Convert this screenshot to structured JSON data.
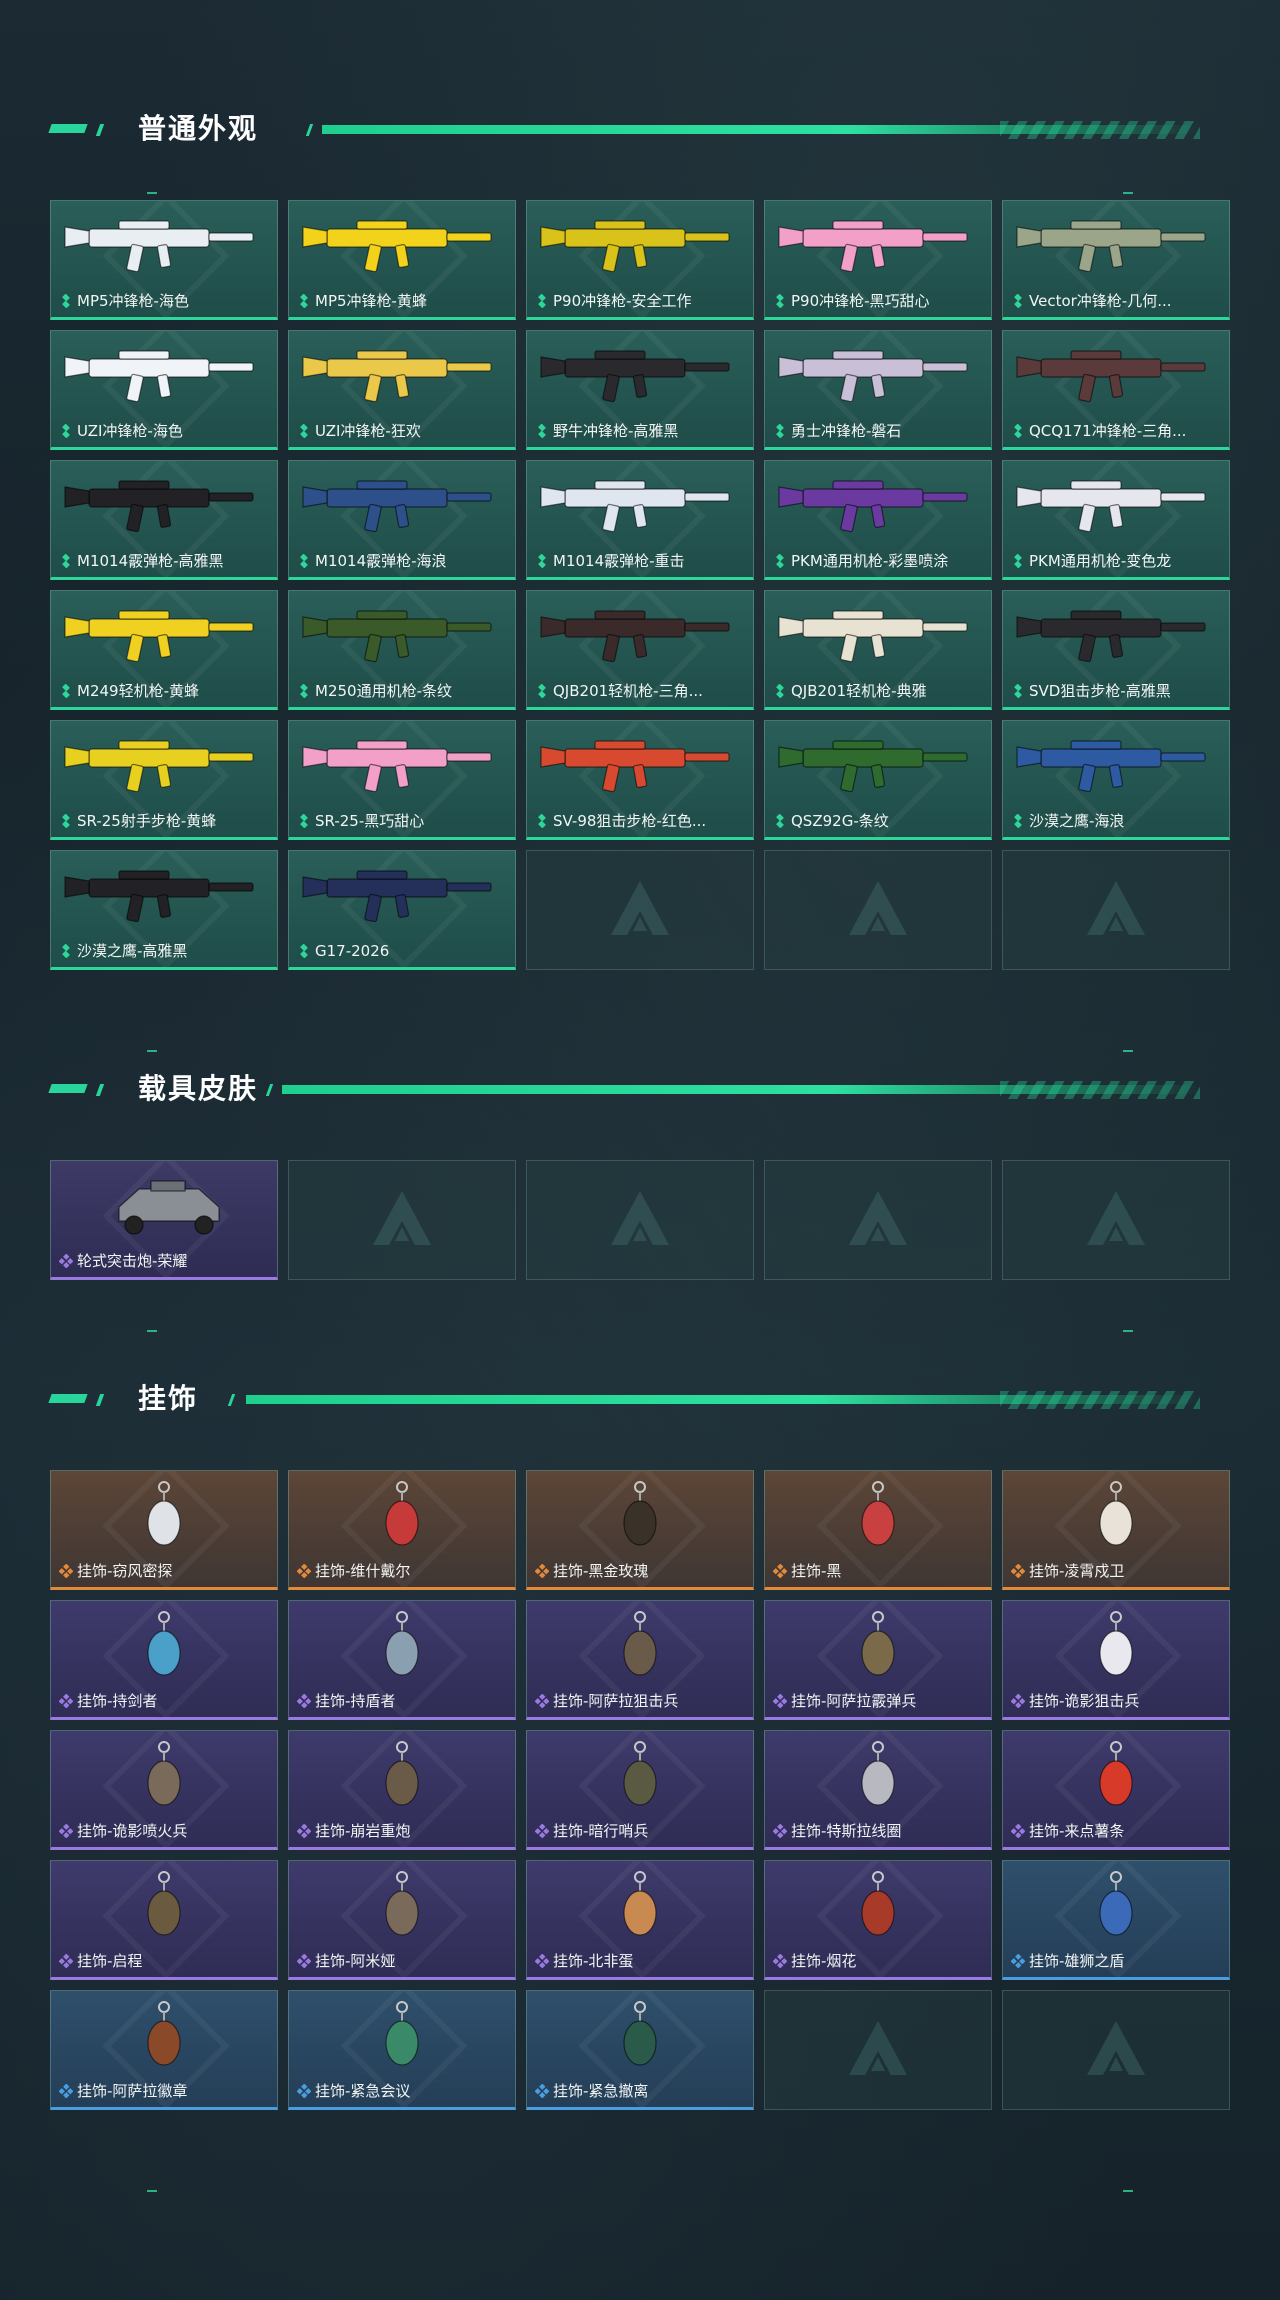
{
  "sections": {
    "weapons": {
      "title": "普通外观",
      "items": [
        "MP5冲锋枪-海色",
        "MP5冲锋枪-黄蜂",
        "P90冲锋枪-安全工作",
        "P90冲锋枪-黑巧甜心",
        "Vector冲锋枪-几何...",
        "UZI冲锋枪-海色",
        "UZI冲锋枪-狂欢",
        "野牛冲锋枪-高雅黑",
        "勇士冲锋枪-磐石",
        "QCQ171冲锋枪-三角...",
        "M1014霰弹枪-高雅黑",
        "M1014霰弹枪-海浪",
        "M1014霰弹枪-重击",
        "PKM通用机枪-彩墨喷涂",
        "PKM通用机枪-变色龙",
        "M249轻机枪-黄蜂",
        "M250通用机枪-条纹",
        "QJB201轻机枪-三角...",
        "QJB201轻机枪-典雅",
        "SVD狙击步枪-高雅黑",
        "SR-25射手步枪-黄蜂",
        "SR-25-黑巧甜心",
        "SV-98狙击步枪-红色...",
        "QSZ92G-条纹",
        "沙漠之鹰-海浪",
        "沙漠之鹰-高雅黑",
        "G17-2026"
      ],
      "empty_count": 3
    },
    "vehicles": {
      "title": "载具皮肤",
      "items": [
        "轮式突击炮-荣耀"
      ],
      "empty_count": 4
    },
    "charms": {
      "title": "挂饰",
      "items": [
        {
          "label": "挂饰-窃风密探",
          "rarity": "orange"
        },
        {
          "label": "挂饰-维什戴尔",
          "rarity": "orange"
        },
        {
          "label": "挂饰-黑金玫瑰",
          "rarity": "orange"
        },
        {
          "label": "挂饰-黑",
          "rarity": "orange"
        },
        {
          "label": "挂饰-凌霄戍卫",
          "rarity": "orange"
        },
        {
          "label": "挂饰-持剑者",
          "rarity": "purple"
        },
        {
          "label": "挂饰-持盾者",
          "rarity": "purple"
        },
        {
          "label": "挂饰-阿萨拉狙击兵",
          "rarity": "purple"
        },
        {
          "label": "挂饰-阿萨拉霰弹兵",
          "rarity": "purple"
        },
        {
          "label": "挂饰-诡影狙击兵",
          "rarity": "purple"
        },
        {
          "label": "挂饰-诡影喷火兵",
          "rarity": "purple"
        },
        {
          "label": "挂饰-崩岩重炮",
          "rarity": "purple"
        },
        {
          "label": "挂饰-暗行哨兵",
          "rarity": "purple"
        },
        {
          "label": "挂饰-特斯拉线圈",
          "rarity": "purple"
        },
        {
          "label": "挂饰-来点薯条",
          "rarity": "purple"
        },
        {
          "label": "挂饰-启程",
          "rarity": "purple"
        },
        {
          "label": "挂饰-阿米娅",
          "rarity": "purple"
        },
        {
          "label": "挂饰-北非蛋",
          "rarity": "purple"
        },
        {
          "label": "挂饰-烟花",
          "rarity": "purple"
        },
        {
          "label": "挂饰-雄狮之盾",
          "rarity": "blue"
        },
        {
          "label": "挂饰-阿萨拉徽章",
          "rarity": "blue"
        },
        {
          "label": "挂饰-紧急会议",
          "rarity": "blue"
        },
        {
          "label": "挂饰-紧急撤离",
          "rarity": "blue"
        }
      ],
      "empty_count": 2
    }
  },
  "colors": {
    "accent": "#2fd69a",
    "orange": "#e28a3c",
    "purple": "#9a7ae0",
    "blue": "#4a9ee0"
  }
}
